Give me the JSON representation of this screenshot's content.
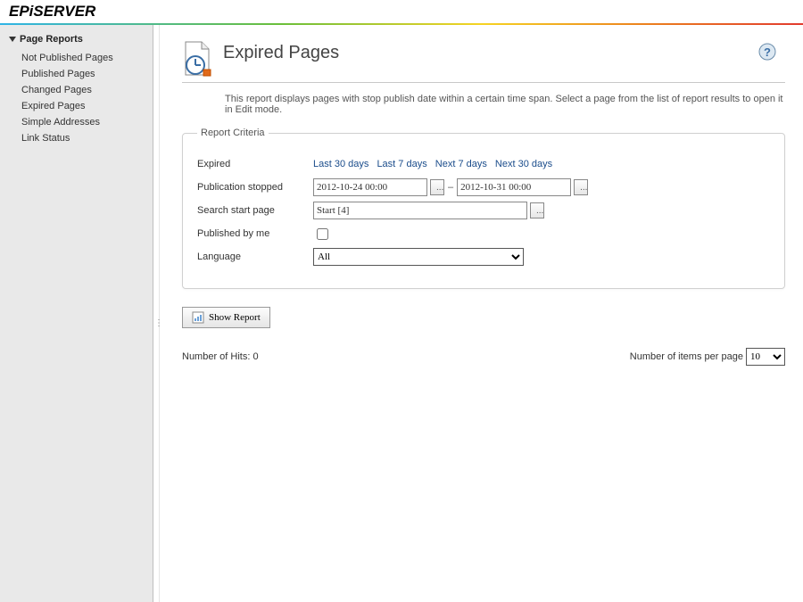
{
  "logo": "EPiSERVER",
  "sidebar": {
    "group_title": "Page Reports",
    "items": [
      {
        "label": "Not Published Pages"
      },
      {
        "label": "Published Pages"
      },
      {
        "label": "Changed Pages"
      },
      {
        "label": "Expired Pages"
      },
      {
        "label": "Simple Addresses"
      },
      {
        "label": "Link Status"
      }
    ]
  },
  "page": {
    "title": "Expired Pages",
    "intro": "This report displays pages with stop publish date within a certain time span. Select a page from the list of report results to open it in Edit mode."
  },
  "criteria": {
    "legend": "Report Criteria",
    "expired_label": "Expired",
    "quick_links": [
      "Last 30 days",
      "Last 7 days",
      "Next 7 days",
      "Next 30 days"
    ],
    "pub_stopped_label": "Publication stopped",
    "pub_from": "2012-10-24 00:00",
    "pub_to": "2012-10-31 00:00",
    "start_page_label": "Search start page",
    "start_page_value": "Start [4]",
    "published_by_me_label": "Published by me",
    "published_by_me_checked": false,
    "language_label": "Language",
    "language_options": [
      "All"
    ],
    "language_selected": "All"
  },
  "actions": {
    "show_report": "Show Report"
  },
  "results": {
    "hits_label": "Number of Hits: 0",
    "ipp_label": "Number of items per page",
    "ipp_options": [
      "10"
    ],
    "ipp_selected": "10"
  },
  "icons": {
    "picker_glyph": "...",
    "sep": "–"
  }
}
